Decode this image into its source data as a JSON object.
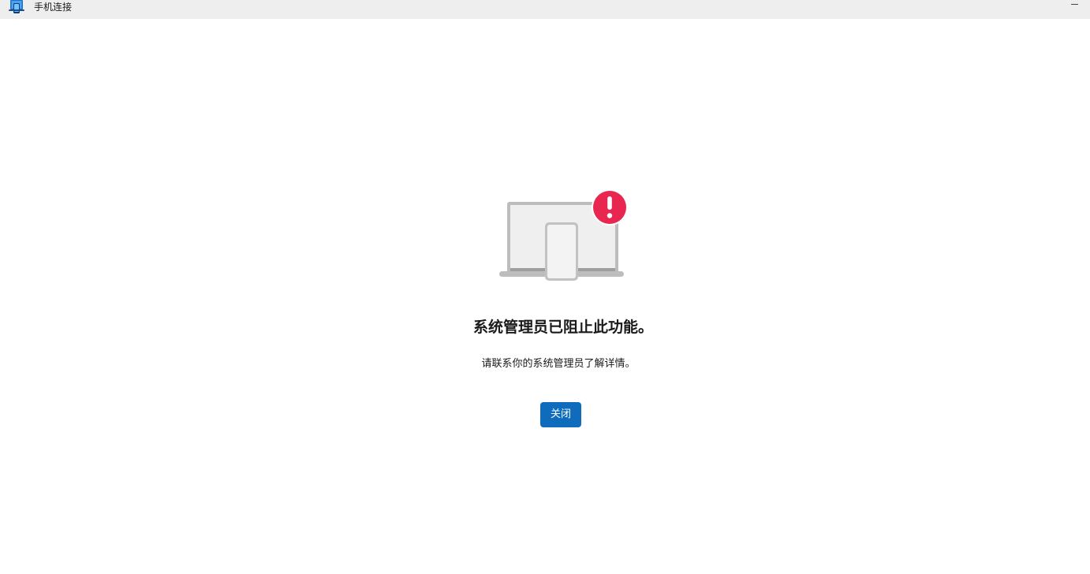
{
  "window": {
    "title": "手机连接",
    "icon": "phone-link-app-icon",
    "minimize_icon": "minimize-icon"
  },
  "illustration": {
    "icon": "laptop-phone-error-illustration",
    "badge_icon": "exclamation-icon",
    "badge_color": "#e8264f"
  },
  "main": {
    "headline": "系统管理员已阻止此功能。",
    "message": "请联系你的系统管理员了解详情。",
    "close_label": "关闭"
  },
  "colors": {
    "accent": "#0f6cbd",
    "titlebar": "#eeeeee"
  }
}
